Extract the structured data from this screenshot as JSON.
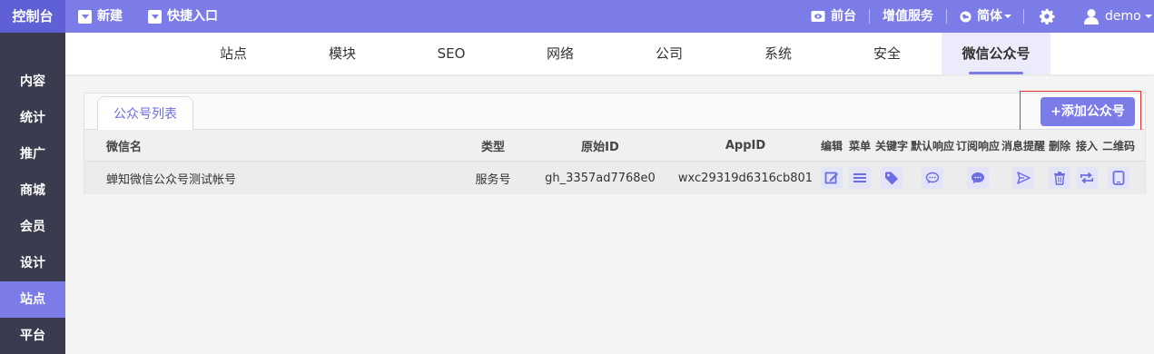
{
  "topbar": {
    "logo": "控制台",
    "new_label": "新建",
    "shortcut_label": "快捷入口",
    "frontend_label": "前台",
    "value_service_label": "增值服务",
    "language_label": "简体",
    "user_label": "demo"
  },
  "sidebar": {
    "items": [
      {
        "label": "内容"
      },
      {
        "label": "统计"
      },
      {
        "label": "推广"
      },
      {
        "label": "商城"
      },
      {
        "label": "会员"
      },
      {
        "label": "设计"
      },
      {
        "label": "站点",
        "active": true
      },
      {
        "label": "平台"
      }
    ]
  },
  "nav": {
    "tabs": [
      {
        "label": "站点"
      },
      {
        "label": "模块"
      },
      {
        "label": "SEO"
      },
      {
        "label": "网络"
      },
      {
        "label": "公司"
      },
      {
        "label": "系统"
      },
      {
        "label": "安全"
      },
      {
        "label": "微信公众号",
        "active": true
      }
    ]
  },
  "panel": {
    "tab_label": "公众号列表",
    "add_button_label": "+添加公众号"
  },
  "table": {
    "headers": {
      "name": "微信名",
      "type": "类型",
      "original_id": "原始ID",
      "appid": "AppID",
      "edit": "编辑",
      "menu": "菜单",
      "keyword": "关键字",
      "default_reply": "默认响应",
      "subscribe_reply": "订阅响应",
      "notify": "消息提醒",
      "delete": "删除",
      "connect": "接入",
      "qrcode": "二维码"
    },
    "rows": [
      {
        "name": "蝉知微信公众号测试帐号",
        "type": "服务号",
        "original_id": "gh_3357ad7768e0",
        "appid": "wxc29319d6316cb801"
      }
    ]
  },
  "colors": {
    "accent": "#7b7ce8",
    "sidebar_bg": "#3a3b4f",
    "highlight_border": "#e03030"
  }
}
